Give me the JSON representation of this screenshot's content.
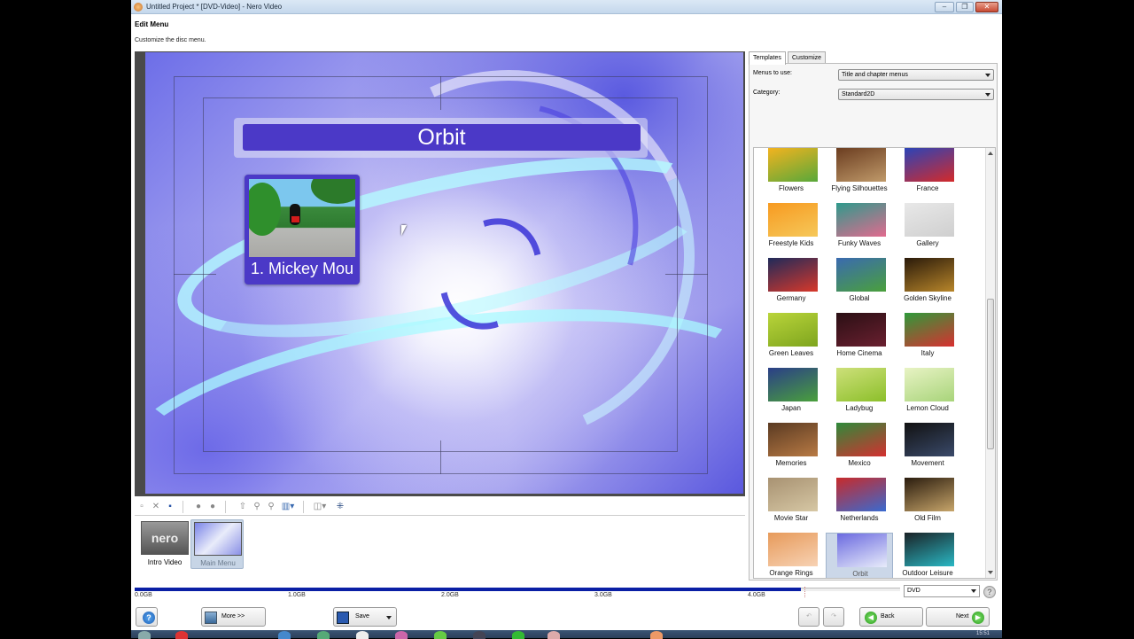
{
  "window": {
    "title": "Untitled Project * [DVD-Video] - Nero Video",
    "controls": {
      "minimize": "–",
      "maximize": "❐",
      "close": "✕"
    }
  },
  "page": {
    "heading": "Edit Menu",
    "subheading": "Customize the disc menu."
  },
  "preview": {
    "menu_title": "Orbit",
    "chapter_label": "1. Mickey Mou",
    "colors": {
      "title_bar": "#4b39c7",
      "background": "#8e8de8"
    }
  },
  "preview_toolbar": {
    "icons": [
      "new-icon",
      "delete-icon",
      "save-icon",
      "prev-icon",
      "next-icon",
      "move-icon",
      "zoom-in-icon",
      "zoom-out-icon",
      "layout-icon",
      "align-icon",
      "grid-icon"
    ]
  },
  "strip": {
    "items": [
      {
        "label": "Intro Video",
        "thumb_text": "nero",
        "selected": false
      },
      {
        "label": "Main Menu",
        "selected": true
      }
    ]
  },
  "right_panel": {
    "tabs": [
      {
        "label": "Templates",
        "active": true
      },
      {
        "label": "Customize",
        "active": false
      }
    ],
    "menus_to_use_label": "Menus to use:",
    "menus_to_use_value": "Title and chapter menus",
    "category_label": "Category:",
    "category_value": "Standard2D",
    "templates": [
      {
        "name": "Flowers",
        "c1": "#f3b31f",
        "c2": "#58a83a"
      },
      {
        "name": "Flying Silhouettes",
        "c1": "#6b3d20",
        "c2": "#c09a6a"
      },
      {
        "name": "France",
        "c1": "#2b44b8",
        "c2": "#d42a2a"
      },
      {
        "name": "Freestyle Kids",
        "c1": "#f79a20",
        "c2": "#f6c85a"
      },
      {
        "name": "Funky Waves",
        "c1": "#2e9a8c",
        "c2": "#e26a8e"
      },
      {
        "name": "Gallery",
        "c1": "#e8e8e8",
        "c2": "#cfcfcf"
      },
      {
        "name": "Germany",
        "c1": "#1f2a5a",
        "c2": "#d8382a"
      },
      {
        "name": "Global",
        "c1": "#3a6ab0",
        "c2": "#4aa03c"
      },
      {
        "name": "Golden Skyline",
        "c1": "#2a1a0a",
        "c2": "#b8862a"
      },
      {
        "name": "Green Leaves",
        "c1": "#b9d43a",
        "c2": "#7ea51e"
      },
      {
        "name": "Home Cinema",
        "c1": "#2a0f14",
        "c2": "#6a2030"
      },
      {
        "name": "Italy",
        "c1": "#2e9a3a",
        "c2": "#d83030"
      },
      {
        "name": "Japan",
        "c1": "#2a3e88",
        "c2": "#4aa03c"
      },
      {
        "name": "Ladybug",
        "c1": "#cde07a",
        "c2": "#8cbf2a"
      },
      {
        "name": "Lemon Cloud",
        "c1": "#e8f3c4",
        "c2": "#a8d47a"
      },
      {
        "name": "Memories",
        "c1": "#5a3a22",
        "c2": "#b87a44"
      },
      {
        "name": "Mexico",
        "c1": "#2e8a3a",
        "c2": "#d43030"
      },
      {
        "name": "Movement",
        "c1": "#111111",
        "c2": "#3a4a6a"
      },
      {
        "name": "Movie Star",
        "c1": "#a89272",
        "c2": "#d6c7a4"
      },
      {
        "name": "Netherlands",
        "c1": "#c82a2a",
        "c2": "#3a6ad0"
      },
      {
        "name": "Old Film",
        "c1": "#2a1c0e",
        "c2": "#c7a56a"
      },
      {
        "name": "Orange Rings",
        "c1": "#e79a5a",
        "c2": "#f7d2b4"
      },
      {
        "name": "Orbit",
        "c1": "#6b6ae0",
        "c2": "#e8ecfa",
        "selected": true
      },
      {
        "name": "Outdoor Leisure",
        "c1": "#1a2226",
        "c2": "#2ab8c4"
      }
    ]
  },
  "capacity": {
    "labels": [
      "0.0GB",
      "1.0GB",
      "2.0GB",
      "3.0GB",
      "4.0GB"
    ],
    "used_fraction": 0.87,
    "fill_color": "#0a1fa5",
    "disc_type": "DVD"
  },
  "footer": {
    "help_label": "?",
    "more_label": "More >>",
    "save_label": "Save",
    "back_label": "Back",
    "next_label": "Next"
  },
  "taskbar": {
    "clock": "15:51"
  }
}
